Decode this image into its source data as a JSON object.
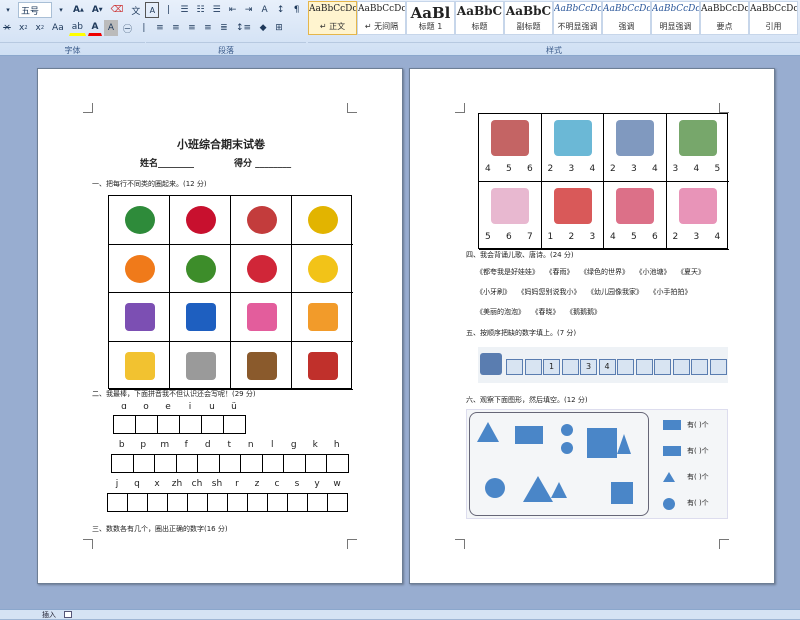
{
  "ribbon": {
    "font_size": "五号",
    "font_group_label": "字体",
    "paragraph_group_label": "段落",
    "styles_group_label": "样式",
    "styles": [
      {
        "sample": "AaBbCcDc",
        "name": "↵ 正文"
      },
      {
        "sample": "AaBbCcDc",
        "name": "↵ 无间隔"
      },
      {
        "sample": "AaBl",
        "name": "标题 1"
      },
      {
        "sample": "AaBbC",
        "name": "标题"
      },
      {
        "sample": "AaBbC",
        "name": "副标题"
      },
      {
        "sample": "AaBbCcDc",
        "name": "不明显强调"
      },
      {
        "sample": "AaBbCcDc",
        "name": "强调"
      },
      {
        "sample": "AaBbCcDc",
        "name": "明显强调"
      },
      {
        "sample": "AaBbCcDc",
        "name": "要点"
      },
      {
        "sample": "AaBbCcDc",
        "name": "引用"
      }
    ]
  },
  "page1": {
    "title": "小班综合期末试卷",
    "name_label": "姓名________",
    "score_label": "得分  ________",
    "q1": "一、把每行不同类的圈起来。(12 分)",
    "q2": "二、我最棒，下面拼音我不但认识还会写呢！(29 分)",
    "vowels": [
      "ɑ",
      "o",
      "e",
      "i",
      "u",
      "ü"
    ],
    "consonants1": [
      "b",
      "p",
      "m",
      "f",
      "d",
      "t",
      "n",
      "l",
      "g",
      "k",
      "h"
    ],
    "consonants2": [
      "j",
      "q",
      "x",
      "zh",
      "ch",
      "sh",
      "r",
      "z",
      "c",
      "s",
      "y",
      "w"
    ],
    "q3": "三、数数各有几个，圈出正确的数字(16 分)"
  },
  "page2": {
    "count_row1": [
      [
        "4",
        "5",
        "6"
      ],
      [
        "2",
        "3",
        "4"
      ],
      [
        "2",
        "3",
        "4"
      ],
      [
        "3",
        "4",
        "5"
      ]
    ],
    "count_row2": [
      [
        "5",
        "6",
        "7"
      ],
      [
        "1",
        "2",
        "3"
      ],
      [
        "4",
        "5",
        "6"
      ],
      [
        "2",
        "3",
        "4"
      ]
    ],
    "q4": "四、我会背诵儿歌、唐诗。(24 分)",
    "poems_row1": [
      "《都夸我是好娃娃》",
      "《春雨》",
      "《绿色的世界》",
      "《小池塘》",
      "《夏天》"
    ],
    "poems_row2": [
      "《小牙刷》",
      "《妈妈您别说我小》",
      "《幼儿园像我家》",
      "《小手拍拍》"
    ],
    "poems_row3": [
      "《美丽的泡泡》",
      "《春晓》",
      "《鹅鹅鹅》"
    ],
    "q5": "五、按顺序把缺的数字填上。(7 分)",
    "train_numbers": [
      "",
      "",
      "1",
      "",
      "3",
      "4",
      "",
      "",
      "",
      "",
      "",
      ""
    ],
    "q6": "六、观察下面图形，然后填空。(12 分)",
    "count_label": "有(    )个"
  },
  "status": {
    "mode": "插入"
  },
  "colors": {
    "accent": "#2b579a",
    "shape_blue": "#4a86c8"
  }
}
